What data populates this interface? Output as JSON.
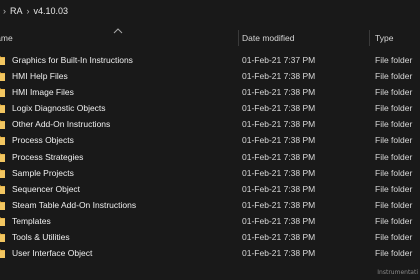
{
  "breadcrumb": {
    "items": [
      "RA",
      "v4.10.03"
    ]
  },
  "header": {
    "name": "Name",
    "date": "Date modified",
    "type": "Type"
  },
  "rows": [
    {
      "name": "Graphics for Built-In Instructions",
      "date": "01-Feb-21 7:37 PM",
      "type": "File folder"
    },
    {
      "name": "HMI Help Files",
      "date": "01-Feb-21 7:38 PM",
      "type": "File folder"
    },
    {
      "name": "HMI Image Files",
      "date": "01-Feb-21 7:38 PM",
      "type": "File folder"
    },
    {
      "name": "Logix Diagnostic Objects",
      "date": "01-Feb-21 7:38 PM",
      "type": "File folder"
    },
    {
      "name": "Other Add-On Instructions",
      "date": "01-Feb-21 7:38 PM",
      "type": "File folder"
    },
    {
      "name": "Process Objects",
      "date": "01-Feb-21 7:38 PM",
      "type": "File folder"
    },
    {
      "name": "Process Strategies",
      "date": "01-Feb-21 7:38 PM",
      "type": "File folder"
    },
    {
      "name": "Sample Projects",
      "date": "01-Feb-21 7:38 PM",
      "type": "File folder"
    },
    {
      "name": "Sequencer Object",
      "date": "01-Feb-21 7:38 PM",
      "type": "File folder"
    },
    {
      "name": "Steam Table Add-On Instructions",
      "date": "01-Feb-21 7:38 PM",
      "type": "File folder"
    },
    {
      "name": "Templates",
      "date": "01-Feb-21 7:38 PM",
      "type": "File folder"
    },
    {
      "name": "Tools & Utilities",
      "date": "01-Feb-21 7:38 PM",
      "type": "File folder"
    },
    {
      "name": "User Interface Object",
      "date": "01-Feb-21 7:38 PM",
      "type": "File folder"
    }
  ],
  "watermark": "Instrumentati",
  "colors": {
    "background": "#191919",
    "folder": "#e8b64a",
    "text": "#f0f0f0"
  },
  "icons": {
    "folder": "folder-icon",
    "chevron": "chevron-right-icon",
    "sort": "sort-up-icon"
  }
}
